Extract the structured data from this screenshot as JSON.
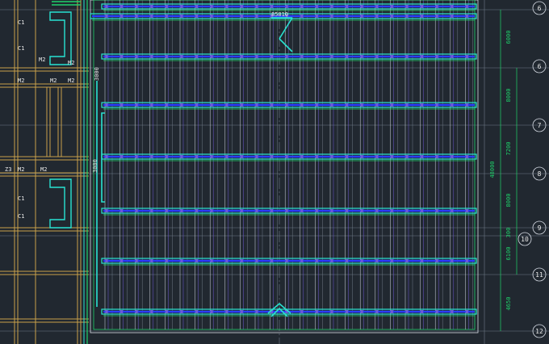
{
  "colors": {
    "background": "#212830",
    "wall": "#c9a14a",
    "cyan_beam": "#29e3d2",
    "green_beam": "#1fd36b",
    "blue_beam": "#2b3cff",
    "purple_line": "#6f5bd6",
    "white_line": "#d8dde6",
    "dim_grid": "#6f7a86",
    "annotation": "#e8e8e8",
    "dimension": "#1fd36b"
  },
  "grid_axes": [
    {
      "label": "6"
    },
    {
      "label": "6"
    },
    {
      "label": "7"
    },
    {
      "label": "8"
    },
    {
      "label": "9"
    },
    {
      "label": "10"
    },
    {
      "label": "11"
    },
    {
      "label": "12"
    }
  ],
  "dimensions": [
    {
      "text": "6000"
    },
    {
      "text": "8000"
    },
    {
      "text": "7200"
    },
    {
      "text": "48000"
    },
    {
      "text": "8000"
    },
    {
      "text": "300"
    },
    {
      "text": "6100"
    },
    {
      "text": "4650"
    }
  ],
  "room_labels": {
    "c1a": "C1",
    "c1b": "C1",
    "c1c": "C1",
    "c1d": "C1",
    "m2a": "M2",
    "m2b": "M2",
    "m2c": "M2",
    "m2d": "M2",
    "m2e": "M2",
    "m2f": "M2",
    "m2g": "M2",
    "z3": "Z3",
    "wall_dim_a": "3000",
    "wall_dim_b": "3000",
    "top_label": "85810"
  }
}
